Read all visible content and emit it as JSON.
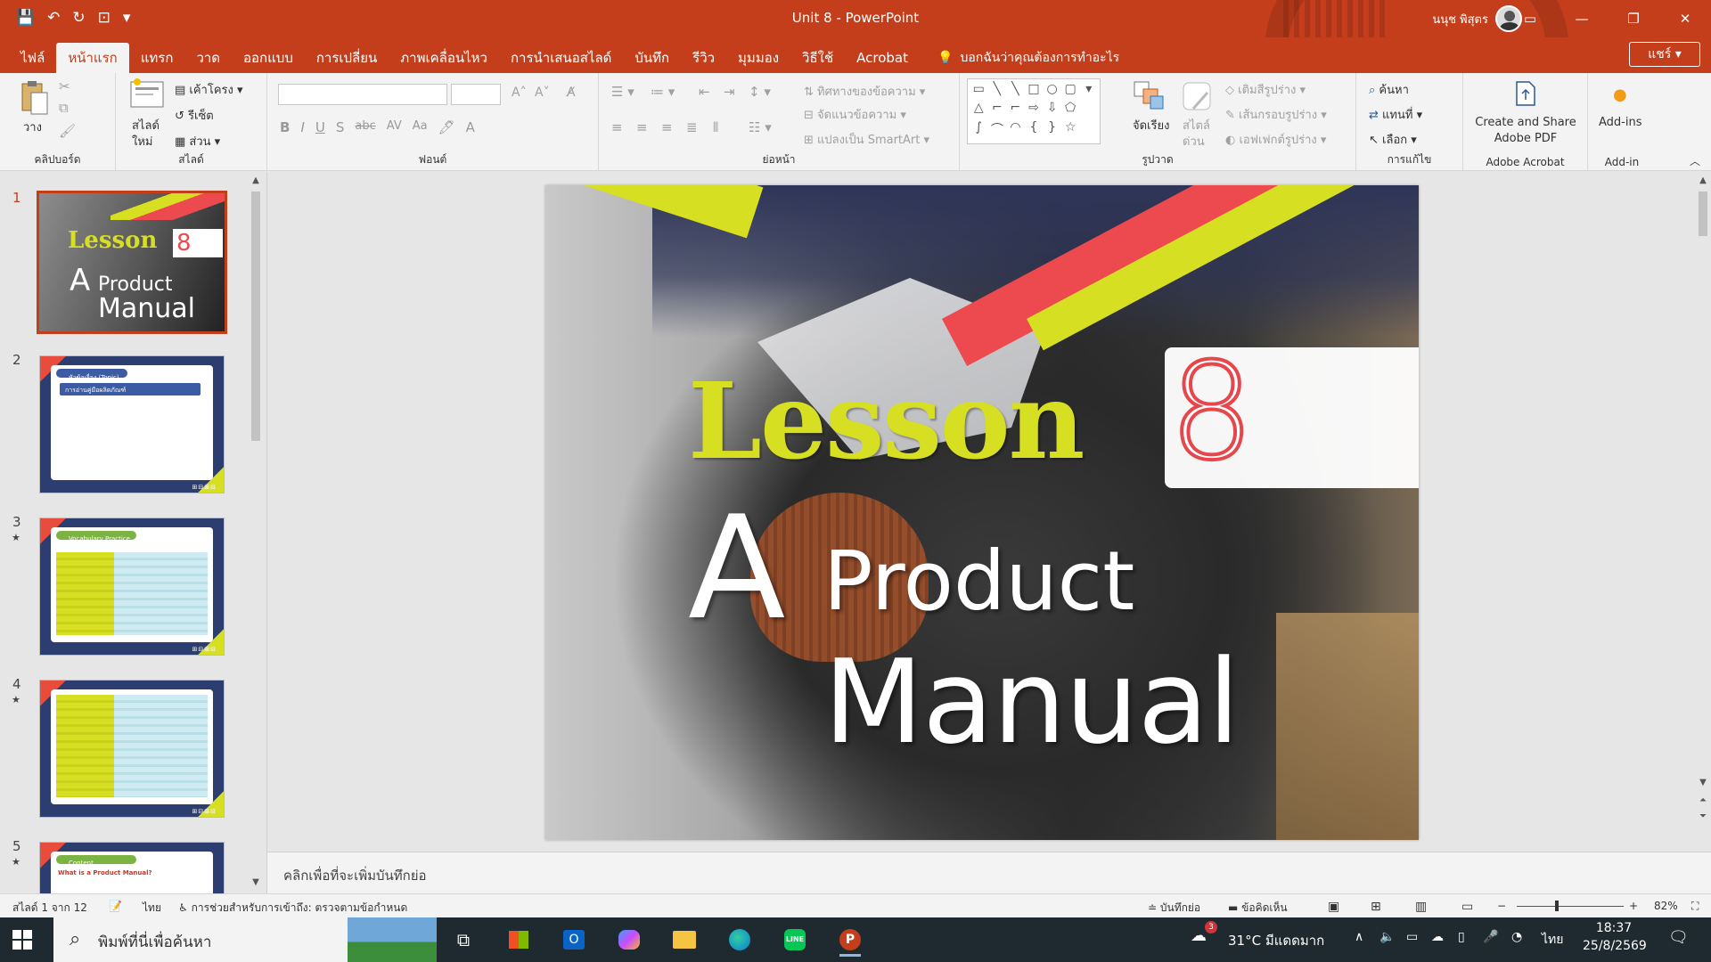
{
  "titlebar": {
    "qat": [
      "💾",
      "↶",
      "↻",
      "⊡",
      "▾"
    ],
    "title": "Unit 8 - PowerPoint",
    "user": "นนุช พิสุตร",
    "window_buttons": [
      "▭",
      "—",
      "❐",
      "✕"
    ]
  },
  "tabs": [
    {
      "label": "ไฟล์"
    },
    {
      "label": "หน้าแรก"
    },
    {
      "label": "แทรก"
    },
    {
      "label": "วาด"
    },
    {
      "label": "ออกแบบ"
    },
    {
      "label": "การเปลี่ยน"
    },
    {
      "label": "ภาพเคลื่อนไหว"
    },
    {
      "label": "การนำเสนอสไลด์"
    },
    {
      "label": "บันทึก"
    },
    {
      "label": "รีวิว"
    },
    {
      "label": "มุมมอง"
    },
    {
      "label": "วิธีใช้"
    },
    {
      "label": "Acrobat"
    }
  ],
  "tell_me": "บอกฉันว่าคุณต้องการทำอะไร",
  "share_label": "แชร์",
  "ribbon": {
    "clipboard": {
      "paste": "วาง",
      "label": "คลิปบอร์ด"
    },
    "slides": {
      "new_slide_1": "สไลด์",
      "new_slide_2": "ใหม่",
      "layout": "เค้าโครง",
      "reset": "รีเซ็ต",
      "section": "ส่วน",
      "label": "สไลด์"
    },
    "font": {
      "label": "ฟอนต์",
      "bold": "B",
      "italic": "I",
      "underline": "U",
      "shadow": "S",
      "strike": "abc",
      "spacing": "AV",
      "case": "Aa"
    },
    "paragraph": {
      "label": "ย่อหน้า",
      "text_direction": "ทิศทางของข้อความ",
      "align_text": "จัดแนวข้อความ",
      "smartart": "แปลงเป็น SmartArt"
    },
    "drawing": {
      "label": "รูปวาด",
      "arrange": "จัดเรียง",
      "quick_styles_1": "สไตล์",
      "quick_styles_2": "ด่วน",
      "fill": "เติมสีรูปร่าง",
      "outline": "เส้นกรอบรูปร่าง",
      "effects": "เอฟเฟกต์รูปร่าง"
    },
    "editing": {
      "label": "การแก้ไข",
      "find": "ค้นหา",
      "replace": "แทนที่",
      "select": "เลือก"
    },
    "acrobat": {
      "label": "Adobe Acrobat",
      "create_1": "Create and Share",
      "create_2": "Adobe PDF"
    },
    "addin": {
      "label": "Add-in",
      "button": "Add-ins"
    }
  },
  "thumbnails": [
    {
      "num": "1",
      "star": ""
    },
    {
      "num": "2",
      "star": "",
      "tag": "หัวข้อเรื่อง (Topic)",
      "bar": "การอ่านคู่มือผลิตภัณฑ์"
    },
    {
      "num": "3",
      "star": "★",
      "tag": "Vocabulary Practice"
    },
    {
      "num": "4",
      "star": "★"
    },
    {
      "num": "5",
      "star": "★",
      "tag": "Content",
      "heading": "What is a Product Manual?"
    }
  ],
  "thumb_slide1": {
    "lesson": "Lesson",
    "num": "8",
    "a": "A",
    "product": "Product",
    "manual": "Manual"
  },
  "slide": {
    "lesson": "Lesson",
    "num": "8",
    "a": "A",
    "product": "Product",
    "manual": "Manual"
  },
  "notes_placeholder": "คลิกเพื่อที่จะเพิ่มบันทึกย่อ",
  "status": {
    "slide_count": "สไลด์ 1 จาก 12",
    "language": "ไทย",
    "accessibility": "การช่วยสำหรับการเข้าถึง: ตรวจตามข้อกำหนด",
    "notes": "บันทึกย่อ",
    "comments": "ข้อคิดเห็น",
    "zoom": "82%"
  },
  "taskbar": {
    "search_placeholder": "พิมพ์ที่นี่เพื่อค้นหา",
    "weather_badge": "3",
    "weather": "31°C มีแดดมาก",
    "lang": "ไทย",
    "time": "18:37",
    "date": "25/8/2569"
  }
}
